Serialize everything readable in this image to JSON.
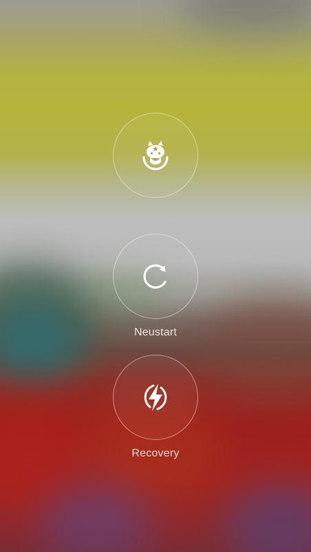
{
  "power_menu": {
    "buttons": [
      {
        "id": "mi",
        "icon": "mi-bunny-icon",
        "label": ""
      },
      {
        "id": "restart",
        "icon": "restart-icon",
        "label": "Neustart"
      },
      {
        "id": "recovery",
        "icon": "recovery-bolt-icon",
        "label": "Recovery"
      }
    ]
  },
  "colors": {
    "icon": "#ffffff",
    "ring": "#ffffffaa",
    "label": "#ffffffd0"
  }
}
